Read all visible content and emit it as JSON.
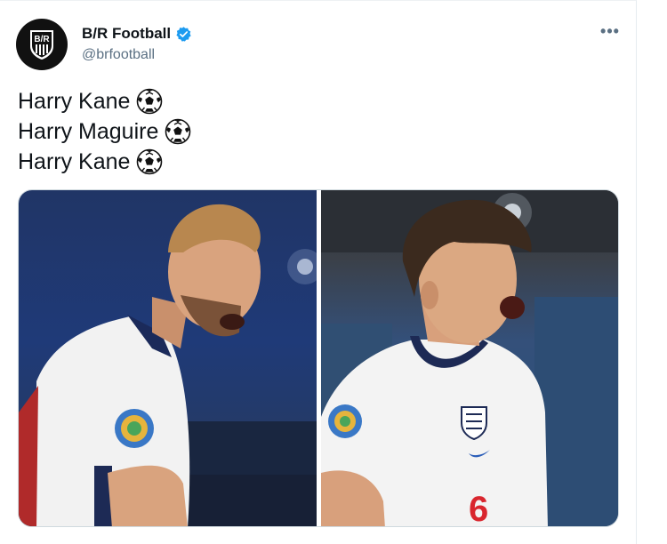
{
  "tweet": {
    "author": {
      "display_name": "B/R Football",
      "handle": "@brfootball",
      "avatar_icon": "br-shield-logo",
      "verified": true,
      "verified_icon": "verified-badge-icon"
    },
    "more_label": "•••",
    "lines": [
      {
        "text": "Harry Kane",
        "emoji": "soccer-ball-icon"
      },
      {
        "text": "Harry Maguire",
        "emoji": "soccer-ball-icon"
      },
      {
        "text": "Harry Kane",
        "emoji": "soccer-ball-icon"
      }
    ],
    "media": [
      {
        "name": "photo-harry-kane"
      },
      {
        "name": "photo-harry-maguire",
        "shirt_number": "6"
      }
    ]
  },
  "colors": {
    "verified_blue": "#1d9bf0",
    "text_primary": "#0f1419",
    "text_secondary": "#5b7083"
  }
}
